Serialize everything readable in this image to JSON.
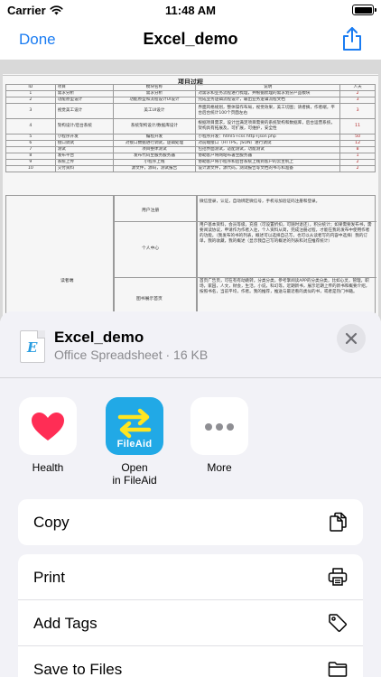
{
  "status_bar": {
    "carrier": "Carrier",
    "time": "11:48 AM"
  },
  "nav": {
    "done_label": "Done",
    "title": "Excel_demo"
  },
  "document": {
    "heading": "项目过程",
    "header_row": [
      "ID",
      "项目",
      "模块名称",
      "说明",
      "人天"
    ],
    "rows": [
      [
        "1",
        "需求分析",
        "需求分析",
        "对需求和业务流程进行梳理，并根据梳理的需求划分产品模块",
        "2"
      ],
      [
        "2",
        "功能原型设计",
        "功能原型和流程设计UI设计",
        "完成业务逻辑流程设计，输出业务逻辑流程文档",
        "3"
      ],
      [
        "3",
        "视觉美工设计",
        "美工UI设计",
        "界面风格规划，整体操作布局，视觉效果，美工切图；请者摘，作者端，平台后台统计100个页面左右",
        "3"
      ],
      [
        "4",
        "架构设计/后台系统",
        "系统架构设计/数据库设计",
        "根据项目需求，设计出满足项目需要的系统架构和数据库，后台运营系统，架构具有拓展及，可扩展，可维护，安全性",
        "11"
      ],
      [
        "5",
        "小程序开发",
        "编程开发",
        "小程序开发：html5+css http+json php",
        "50"
      ],
      [
        "6",
        "接口调试",
        "对接口数据进行调试，逻辑处理",
        "对前端接口（HTTPS，JSON）进行调试",
        "12"
      ],
      [
        "7",
        "测试",
        "项目整体测试",
        "包括界面测试，适配测试，功能测试",
        "8"
      ],
      [
        "8",
        "发布平台",
        "发布代码至服务服务器",
        "协助客户将网站布署至服务器",
        "1"
      ],
      [
        "9",
        "系统上传",
        "小程序上线",
        "协助客户将小程序和后台系统上线到客户的云主机上",
        "2"
      ],
      [
        "10",
        "交付资料",
        "源文件，源码，测试报告",
        "设计源文件，源代码，测试报告等文档的书写和准备",
        "2"
      ]
    ],
    "lower": {
      "group_label": "读者端",
      "sections": [
        {
          "label": "用户注册",
          "text": "微信登录，认证，自动绑定微信号，手机号加验证码注册和登录。"
        },
        {
          "label": "个人中心",
          "text": "用户基本资料，会员等级，充值（可设置折扣，可随时退还），积分统计；如果需要发布书，需要阅读协议，申请作为作者入驻，个人资料从简，完成注册过程，才能在我的发布中使用作者的功能。（我发布的书的列表，概述可以选择自己写，也可以从读者写的内容中选择）我的订单，我的收藏，我的概述（显示我自己写的概述的列表和对应推荐统计）"
        },
        {
          "label": "图书展示首页",
          "text": "首页广告页，可在有有动跳转。分类分类，参考掌阅读APP的分类分类，比如心灵，管理，职场，家园，人文，财会，生活，小说，科幻等。近期新书，展示近期上传的新书和概要介绍，按照书名，当前平均，作者。我的推荐，推送与最近看的类似的书，或者是热门书籍。"
        }
      ]
    }
  },
  "sheet": {
    "file_name": "Excel_demo",
    "file_subtitle": "Office Spreadsheet · 16 KB",
    "file_icon_letter": "E",
    "apps": [
      {
        "label": "Health",
        "icon": "health-heart-icon"
      },
      {
        "label_line1": "Open",
        "label_line2": "in FileAid",
        "tile_text": "FileAid",
        "icon": "fileaid-icon"
      },
      {
        "label": "More",
        "icon": "more-dots-icon"
      }
    ],
    "actions": [
      {
        "label": "Copy",
        "icon": "copy-icon"
      },
      {
        "label": "Print",
        "icon": "printer-icon"
      },
      {
        "label": "Add Tags",
        "icon": "tag-icon"
      },
      {
        "label": "Save to Files",
        "icon": "folder-icon"
      }
    ]
  },
  "colors": {
    "accent": "#1a7cf2",
    "fileaid_tile": "#21a9e6",
    "health_heart": "#ff2d55",
    "sheet_bg": "#f2f2f7"
  }
}
